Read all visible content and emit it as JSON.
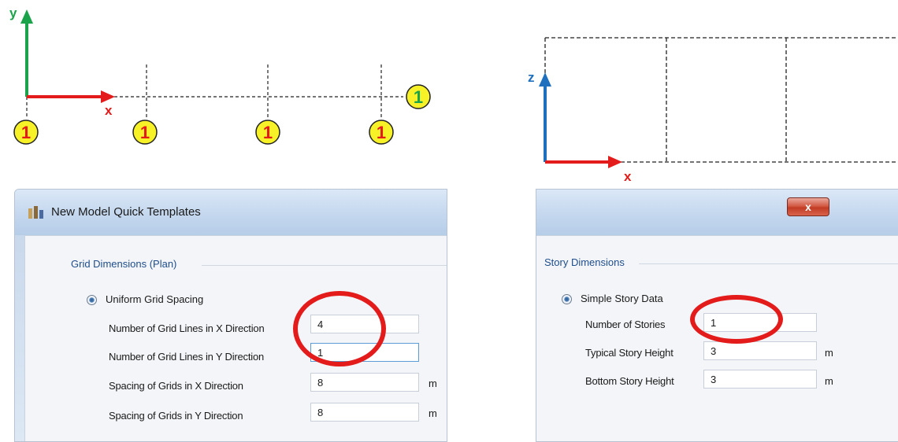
{
  "plan_view": {
    "axis_x_label": "x",
    "axis_y_label": "y",
    "x_grid_labels": [
      "1",
      "1",
      "1",
      "1"
    ],
    "y_grid_label": "1"
  },
  "elevation_view": {
    "axis_x_label": "x",
    "axis_z_label": "z"
  },
  "colors": {
    "axis_x": "#e31b1b",
    "axis_y": "#1aa34a",
    "axis_z": "#1f6fbf",
    "grid_badge_fill": "#f7f227",
    "x_grid_text": "#e31b1b",
    "y_grid_text": "#1aa34a",
    "highlight": "#e31b1b"
  },
  "left_dialog": {
    "title": "New Model Quick Templates",
    "icon": "app-icon",
    "group_title": "Grid Dimensions (Plan)",
    "radio_label": "Uniform Grid Spacing",
    "fields": [
      {
        "label": "Number of Grid Lines in X Direction",
        "value": "4",
        "unit": ""
      },
      {
        "label": "Number of Grid Lines in Y Direction",
        "value": "1",
        "unit": ""
      },
      {
        "label": "Spacing of Grids in X Direction",
        "value": "8",
        "unit": "m"
      },
      {
        "label": "Spacing of Grids in Y Direction",
        "value": "8",
        "unit": "m"
      }
    ]
  },
  "right_dialog": {
    "close_label": "x",
    "group_title": "Story Dimensions",
    "radio_label": "Simple Story Data",
    "fields": [
      {
        "label": "Number of Stories",
        "value": "1",
        "unit": ""
      },
      {
        "label": "Typical Story Height",
        "value": "3",
        "unit": "m"
      },
      {
        "label": "Bottom Story Height",
        "value": "3",
        "unit": "m"
      }
    ]
  }
}
